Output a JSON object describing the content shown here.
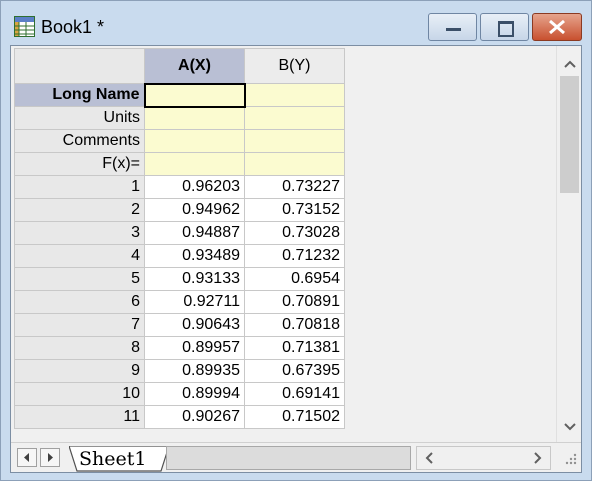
{
  "window": {
    "title": "Book1 *",
    "icon": "workbook-grid-icon",
    "buttons": [
      "minimize-icon",
      "maximize-icon",
      "close-icon"
    ]
  },
  "sheet": {
    "columns": [
      {
        "label": "A(X)",
        "selected": true
      },
      {
        "label": "B(Y)",
        "selected": false
      }
    ],
    "meta_rows": [
      "Long Name",
      "Units",
      "Comments",
      "F(x)="
    ],
    "rows": [
      {
        "index": "1",
        "a": "0.96203",
        "b": "0.73227"
      },
      {
        "index": "2",
        "a": "0.94962",
        "b": "0.73152"
      },
      {
        "index": "3",
        "a": "0.94887",
        "b": "0.73028"
      },
      {
        "index": "4",
        "a": "0.93489",
        "b": "0.71232"
      },
      {
        "index": "5",
        "a": "0.93133",
        "b": "0.6954"
      },
      {
        "index": "6",
        "a": "0.92711",
        "b": "0.70891"
      },
      {
        "index": "7",
        "a": "0.90643",
        "b": "0.70818"
      },
      {
        "index": "8",
        "a": "0.89957",
        "b": "0.71381"
      },
      {
        "index": "9",
        "a": "0.89935",
        "b": "0.67395"
      },
      {
        "index": "10",
        "a": "0.89994",
        "b": "0.69141"
      },
      {
        "index": "11",
        "a": "0.90267",
        "b": "0.71502"
      }
    ]
  },
  "tabs": {
    "active": "Sheet1"
  },
  "colors": {
    "selected_header": "#b9bfd4",
    "meta_fill": "#fbfbd0",
    "close_button": "#c8502f"
  }
}
